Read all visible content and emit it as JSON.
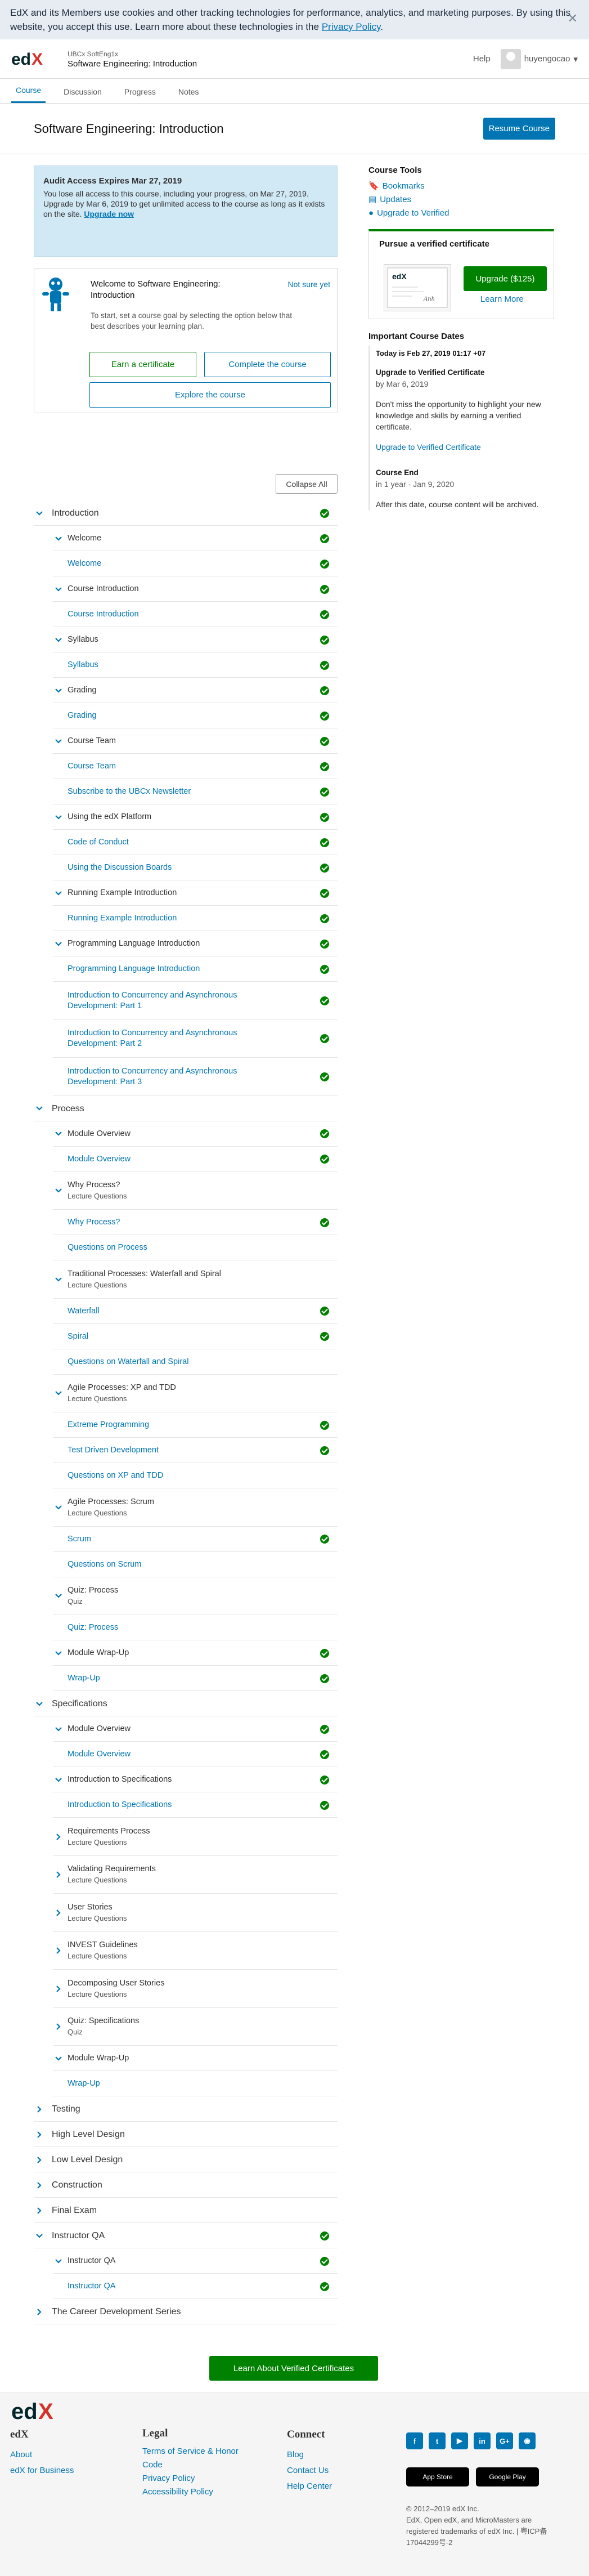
{
  "cookie_banner": {
    "text": "EdX and its Members use cookies and other tracking technologies for performance, analytics, and marketing purposes. By using this website, you accept this use. Learn more about these technologies in the",
    "link": "Privacy Policy",
    "period": "."
  },
  "header": {
    "org": "UBCx SoftEng1x",
    "course": "Software Engineering: Introduction",
    "help": "Help",
    "username": "huyengocao"
  },
  "tabs": [
    "Course",
    "Discussion",
    "Progress",
    "Notes"
  ],
  "title": {
    "heading": "Software Engineering: Introduction",
    "resume": "Resume Course"
  },
  "audit": {
    "title": "Audit Access Expires Mar 27, 2019",
    "line1": "You lose all access to this course, including your progress, on Mar 27, 2019.",
    "line2": "Upgrade by Mar 6, 2019 to get unlimited access to the course as long as it exists on the site.",
    "link": "Upgrade now"
  },
  "welcome": {
    "title": "Welcome to Software Engineering: Introduction",
    "not_sure": "Not sure yet",
    "desc": "To start, set a course goal by selecting the option below that best describes your learning plan.",
    "earn": "Earn a certificate",
    "complete": "Complete the course",
    "explore": "Explore the course"
  },
  "collapse_all": "Collapse All",
  "outline": [
    {
      "type": "section",
      "text": "Introduction",
      "y": 0,
      "done": true
    },
    {
      "type": "sub",
      "text": "Welcome",
      "y": 1,
      "done": true
    },
    {
      "type": "unit",
      "text": "Welcome",
      "y": 2,
      "done": true
    },
    {
      "type": "sub",
      "text": "Course Introduction",
      "y": 3,
      "done": true
    },
    {
      "type": "unit",
      "text": "Course Introduction",
      "y": 4,
      "done": true
    },
    {
      "type": "sub",
      "text": "Syllabus",
      "y": 5,
      "done": true
    },
    {
      "type": "unit",
      "text": "Syllabus",
      "y": 6,
      "done": true
    },
    {
      "type": "sub",
      "text": "Grading",
      "y": 7,
      "done": true
    },
    {
      "type": "unit",
      "text": "Grading",
      "y": 8,
      "done": true
    },
    {
      "type": "sub",
      "text": "Course Team",
      "y": 9,
      "done": true
    },
    {
      "type": "unit",
      "text": "Course Team",
      "y": 10,
      "done": true
    },
    {
      "type": "unit",
      "text": "Subscribe to the UBCx Newsletter",
      "y": 11,
      "done": true
    },
    {
      "type": "sub",
      "text": "Using the edX Platform",
      "y": 12,
      "done": true
    },
    {
      "type": "unit",
      "text": "Code of Conduct",
      "y": 13,
      "done": true
    },
    {
      "type": "unit",
      "text": "Using the Discussion Boards",
      "y": 14,
      "done": true
    },
    {
      "type": "sub",
      "text": "Running Example Introduction",
      "y": 15,
      "done": true
    },
    {
      "type": "unit",
      "text": "Running Example Introduction",
      "y": 16,
      "done": true
    },
    {
      "type": "sub",
      "text": "Programming Language Introduction",
      "y": 17,
      "done": true
    },
    {
      "type": "unit",
      "text": "Programming Language Introduction",
      "y": 18,
      "done": true
    },
    {
      "type": "unit2",
      "text": "Introduction to Concurrency and Asynchronous",
      "text2": "Development: Part 1",
      "y": 19,
      "done": true
    },
    {
      "type": "unit2",
      "text": "Introduction to Concurrency and Asynchronous",
      "text2": "Development: Part 2",
      "y": 20.5,
      "done": true
    },
    {
      "type": "unit2",
      "text": "Introduction to Concurrency and Asynchronous",
      "text2": "Development: Part 3",
      "y": 22,
      "done": true
    },
    {
      "type": "section",
      "text": "Process",
      "y": 23.5,
      "done": false
    },
    {
      "type": "sub",
      "text": "Module Overview",
      "y": 24.5,
      "done": true
    },
    {
      "type": "unit",
      "text": "Module Overview",
      "y": 25.5,
      "done": true
    },
    {
      "type": "sub2",
      "text": "Why Process?",
      "text2": "Lecture Questions",
      "y": 26.5,
      "done": false
    },
    {
      "type": "unit",
      "text": "Why Process?",
      "y": 28,
      "done": true
    },
    {
      "type": "unit",
      "text": "Questions on Process",
      "y": 29,
      "done": false
    },
    {
      "type": "sub2",
      "text": "Traditional Processes: Waterfall and Spiral",
      "text2": "Lecture Questions",
      "y": 30,
      "done": false
    },
    {
      "type": "unit",
      "text": "Waterfall",
      "y": 31.5,
      "done": true
    },
    {
      "type": "unit",
      "text": "Spiral",
      "y": 32.5,
      "done": true
    },
    {
      "type": "unit",
      "text": "Questions on Waterfall and Spiral",
      "y": 33.5,
      "done": false
    },
    {
      "type": "sub2",
      "text": "Agile Processes: XP and TDD",
      "text2": "Lecture Questions",
      "y": 34.5,
      "done": false
    },
    {
      "type": "unit",
      "text": "Extreme Programming",
      "y": 36,
      "done": true
    },
    {
      "type": "unit",
      "text": "Test Driven Development",
      "y": 37,
      "done": true
    },
    {
      "type": "unit",
      "text": "Questions on XP and TDD",
      "y": 38,
      "done": false
    },
    {
      "type": "sub2",
      "text": "Agile Processes: Scrum",
      "text2": "Lecture Questions",
      "y": 39,
      "done": false
    },
    {
      "type": "unit",
      "text": "Scrum",
      "y": 40.5,
      "done": true
    },
    {
      "type": "unit",
      "text": "Questions on Scrum",
      "y": 41.5,
      "done": false
    },
    {
      "type": "sub2",
      "text": "Quiz: Process",
      "text2": "Quiz",
      "y": 42.5,
      "done": false
    },
    {
      "type": "unit",
      "text": "Quiz: Process",
      "y": 44,
      "done": false
    },
    {
      "type": "sub",
      "text": "Module Wrap-Up",
      "y": 45,
      "done": true
    },
    {
      "type": "unit",
      "text": "Wrap-Up",
      "y": 46,
      "done": true
    },
    {
      "type": "section",
      "text": "Specifications",
      "y": 47,
      "done": false
    },
    {
      "type": "sub",
      "text": "Module Overview",
      "y": 48,
      "done": true
    },
    {
      "type": "unit",
      "text": "Module Overview",
      "y": 49,
      "done": true
    },
    {
      "type": "sub",
      "text": "Introduction to Specifications",
      "y": 50,
      "done": true
    },
    {
      "type": "unit",
      "text": "Introduction to Specifications",
      "y": 51,
      "done": true
    },
    {
      "type": "csub2",
      "text": "Requirements Process",
      "text2": "Lecture Questions",
      "y": 52,
      "done": false
    },
    {
      "type": "csub2",
      "text": "Validating Requirements",
      "text2": "Lecture Questions",
      "y": 53.5,
      "done": false
    },
    {
      "type": "csub2",
      "text": "User Stories",
      "text2": "Lecture Questions",
      "y": 55,
      "done": false
    },
    {
      "type": "csub2",
      "text": "INVEST Guidelines",
      "text2": "Lecture Questions",
      "y": 56.5,
      "done": false
    },
    {
      "type": "csub2",
      "text": "Decomposing User Stories",
      "text2": "Lecture Questions",
      "y": 58,
      "done": false
    },
    {
      "type": "csub2",
      "text": "Quiz: Specifications",
      "text2": "Quiz",
      "y": 59.5,
      "done": false
    },
    {
      "type": "sub",
      "text": "Module Wrap-Up",
      "y": 61,
      "done": false
    },
    {
      "type": "unit",
      "text": "Wrap-Up",
      "y": 62,
      "done": false
    },
    {
      "type": "csection",
      "text": "Testing",
      "y": 63,
      "done": false
    },
    {
      "type": "csection",
      "text": "High Level Design",
      "y": 64,
      "done": false
    },
    {
      "type": "csection",
      "text": "Low Level Design",
      "y": 65,
      "done": false
    },
    {
      "type": "csection",
      "text": "Construction",
      "y": 66,
      "done": false
    },
    {
      "type": "csection",
      "text": "Final Exam",
      "y": 67,
      "done": false
    },
    {
      "type": "section",
      "text": "Instructor QA",
      "y": 68,
      "done": true
    },
    {
      "type": "sub",
      "text": "Instructor QA",
      "y": 69,
      "done": true
    },
    {
      "type": "unit",
      "text": "Instructor QA",
      "y": 70,
      "done": true
    },
    {
      "type": "csection",
      "text": "The Career Development Series",
      "y": 71,
      "done": false
    }
  ],
  "aside": {
    "tools_title": "Course Tools",
    "bookmarks": "Bookmarks",
    "updates": "Updates",
    "upgrade": "Upgrade to Verified",
    "verify_title": "Pursue a verified certificate",
    "upgrade_btn": "Upgrade ($125)",
    "learn_more": "Learn More",
    "dates_title": "Important Course Dates",
    "today": "Today is Feb 27, 2019 01:17 +07",
    "d1_h": "Upgrade to Verified Certificate",
    "d1_d": "by Mar 6, 2019",
    "d1_p": "Don't miss the opportunity to highlight your new knowledge and skills by earning a verified certificate.",
    "d1_link": "Upgrade to Verified Certificate",
    "d2_h": "Course End",
    "d2_d": "in 1 year - Jan 9, 2020",
    "d2_p": "After this date, course content will be archived."
  },
  "learn_cert_btn": "Learn About Verified Certificates",
  "footer": {
    "edx": "edX",
    "about": "About",
    "business": "edX for Business",
    "legal": "Legal",
    "tos": "Terms of Service & Honor Code",
    "privacy": "Privacy Policy",
    "access": "Accessibility Policy",
    "connect": "Connect",
    "blog": "Blog",
    "contact": "Contact Us",
    "help": "Help Center",
    "appstore": "App Store",
    "googleplay": "Google Play",
    "copy1": "© 2012–2019 edX Inc.",
    "copy2": "EdX, Open edX, and MicroMasters are registered trademarks of edX Inc. | 粤ICP备17044299号-2"
  }
}
